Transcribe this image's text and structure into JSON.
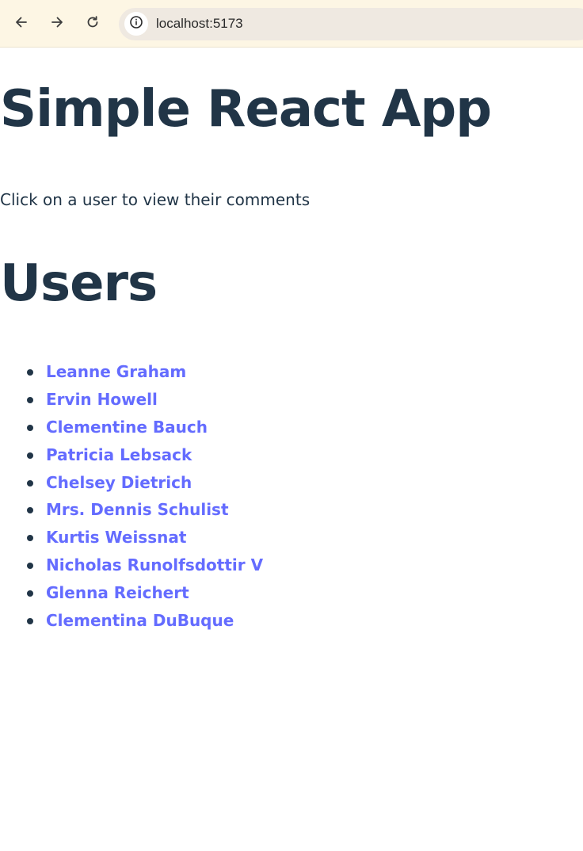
{
  "browser": {
    "url": "localhost:5173",
    "icons": {
      "back": "back-arrow-icon",
      "forward": "forward-arrow-icon",
      "reload": "reload-icon",
      "site_info": "info-icon"
    }
  },
  "main": {
    "title": "Simple React App",
    "subtitle": "Click on a user to view their comments",
    "users_heading": "Users",
    "users": [
      "Leanne Graham",
      "Ervin Howell",
      "Clementine Bauch",
      "Patricia Lebsack",
      "Chelsey Dietrich",
      "Mrs. Dennis Schulist",
      "Kurtis Weissnat",
      "Nicholas Runolfsdottir V",
      "Glenna Reichert",
      "Clementina DuBuque"
    ]
  },
  "colors": {
    "text": "#213547",
    "link": "#646cff",
    "toolbar": "#fdf6e4",
    "address_bar": "#efe9e1"
  }
}
